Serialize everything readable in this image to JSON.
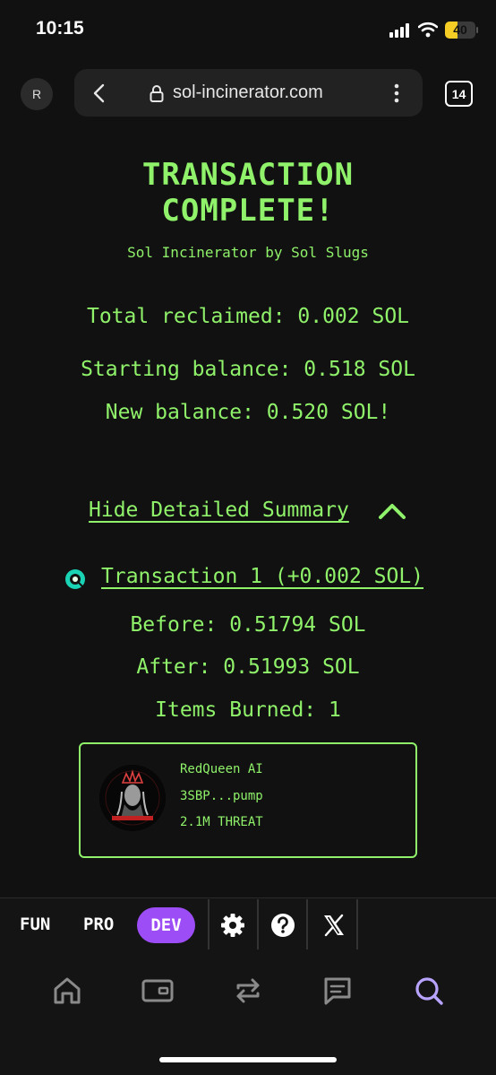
{
  "status_bar": {
    "time": "10:15",
    "battery": "40",
    "battery_level": 0.4
  },
  "browser": {
    "avatar_letter": "R",
    "url": "sol-incinerator.com",
    "tab_count": "14"
  },
  "header": {
    "title_line1": "TRANSACTION",
    "title_line2": "COMPLETE!",
    "subtitle": "Sol Incinerator by Sol Slugs"
  },
  "summary": {
    "total_reclaimed": "Total reclaimed: 0.002 SOL",
    "starting_balance": "Starting balance: 0.518 SOL",
    "new_balance": "New balance: 0.520 SOL!"
  },
  "details": {
    "toggle_label": "Hide Detailed Summary",
    "transaction_label": "Transaction 1 (+0.002 SOL)",
    "before": "Before: 0.51794 SOL",
    "after": "After: 0.51993 SOL",
    "items_burned": "Items Burned: 1",
    "token": {
      "name": "RedQueen AI",
      "address": "3SBP...pump",
      "amount": "2.1M THREAT"
    }
  },
  "toolbar": {
    "fun_label": "FUN",
    "pro_label": "PRO",
    "dev_label": "DEV"
  },
  "colors": {
    "accent_green": "#8ff26a",
    "dev_purple": "#9d4df5",
    "nav_active": "#b8a4ff",
    "background": "#111111"
  },
  "icons": [
    "back-icon",
    "lock-icon",
    "more-icon",
    "chevron-up-icon",
    "transaction-icon",
    "gear-icon",
    "help-icon",
    "x-icon",
    "home-icon",
    "wallet-icon",
    "swap-icon",
    "chat-icon",
    "search-icon"
  ]
}
